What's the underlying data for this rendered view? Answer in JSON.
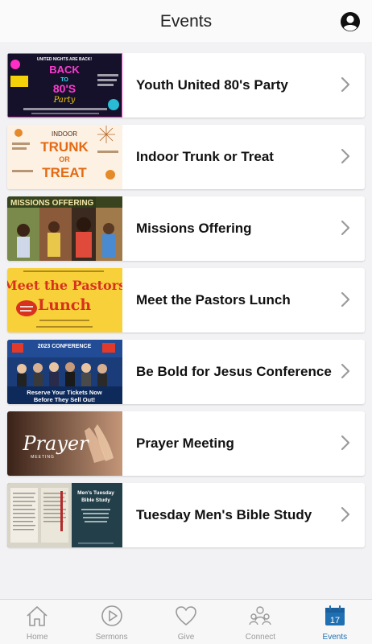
{
  "header": {
    "title": "Events"
  },
  "events": [
    {
      "title": "Youth United 80's Party"
    },
    {
      "title": "Indoor Trunk or Treat"
    },
    {
      "title": "Missions Offering"
    },
    {
      "title": "Meet the Pastors Lunch"
    },
    {
      "title": "Be Bold for Jesus Conference"
    },
    {
      "title": "Prayer Meeting"
    },
    {
      "title": "Tuesday Men's Bible Study"
    }
  ],
  "thumbs": {
    "t0": {
      "line1": "UNITED NIGHTS ARE BACK!",
      "big1": "BACK",
      "big2": "TO",
      "big3": "80'S",
      "big4": "Party"
    },
    "t1": {
      "top": "INDOOR",
      "big1": "TRUNK",
      "mid": "OR",
      "big2": "TREAT"
    },
    "t2": {
      "banner": "MISSIONS OFFERING"
    },
    "t3": {
      "big1": "Meet the Pastors",
      "big2": "Lunch"
    },
    "t4": {
      "conf": "2023 CONFERENCE",
      "line1": "Reserve Your Tickets Now",
      "line2": "Before They Sell Out!"
    },
    "t5": {
      "word": "Prayer",
      "sub": "MEETING"
    },
    "t6": {
      "line1": "Men's Tuesday",
      "line2": "Bible Study"
    }
  },
  "tabs": [
    {
      "label": "Home",
      "icon": "home-icon",
      "active": false
    },
    {
      "label": "Sermons",
      "icon": "play-icon",
      "active": false
    },
    {
      "label": "Give",
      "icon": "heart-icon",
      "active": false
    },
    {
      "label": "Connect",
      "icon": "people-icon",
      "active": false
    },
    {
      "label": "Events",
      "icon": "calendar-icon",
      "active": true,
      "badge": "17"
    }
  ],
  "colors": {
    "accent": "#1f6fb3",
    "inactive": "#999999",
    "background": "#f2f2f4"
  }
}
